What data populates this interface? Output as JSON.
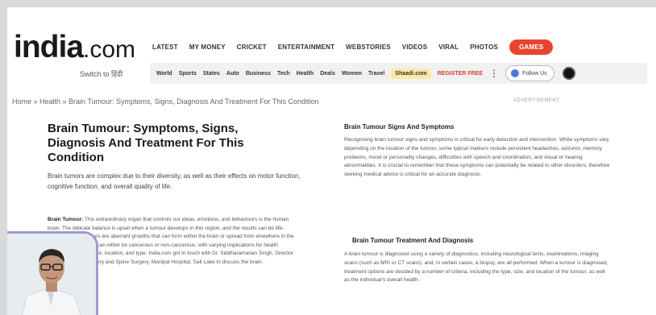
{
  "header": {
    "logo_main": "india",
    "logo_suffix": ".com",
    "switch_label": "Switch to हिंदी",
    "top_nav": [
      "LATEST",
      "MY MONEY",
      "CRICKET",
      "ENTERTAINMENT",
      "WEBSTORIES",
      "VIDEOS",
      "VIRAL",
      "PHOTOS"
    ],
    "games_label": "GAMES",
    "sub_nav": [
      "World",
      "Sports",
      "States",
      "Auto",
      "Business",
      "Tech",
      "Health",
      "Deals",
      "Women",
      "Travel"
    ],
    "shaadi_label": "Shaadi.com",
    "register_label": "REGISTER FREE",
    "follow_label": "Follow Us"
  },
  "breadcrumb": "Home » Health » Brain Tumour: Symptoms, Signs, Diagnosis And Treatment For This Condition",
  "ad_label": "ADVERTISEMENT",
  "article": {
    "title": "Brain Tumour: Symptoms, Signs, Diagnosis And Treatment For This Condition",
    "intro": "Brain tumors are complex due to their diversity, as well as their effects on motor function, cognitive function, and overall quality of life.",
    "para_lead": "Brain Tumour:",
    "para_body": "This extraordinary organ that controls our ideas, emotions, and behaviours is the human brain. The delicate balance is upset when a tumour develops in this region, and the results can be life-altering. Brain tumours are aberrant growths that can form within the brain or spread from elsewhere in the body. These growths can either be cancerous or non-cancerous, with varying implications for health depending on their size, location, and type. India.com got in touch with Dr. Siddharamanan Singh, Director and HOD, Neurosurgery and Spine Surgery, Manipal Hospital, Salt Lake to discuss the brain."
  },
  "right": {
    "heading1": "Brain Tumour Signs And Symptoms",
    "text1": "Recognising brain tumour signs and symptoms is critical for early detection and intervention. While symptoms vary depending on the location of the tumour, some typical markers include persistent headaches, seizures, memory problems, mood or personality changes, difficulties with speech and coordination, and visual or hearing abnormalities. It is crucial to remember that these symptoms can potentially be related to other disorders, therefore seeking medical advice is critical for an accurate diagnosis.",
    "heading2": "Brain Tumour Treatment And Diagnosis",
    "text2": "A brain tumour is diagnosed using a variety of diagnostics, including neurological tests, examinations, imaging scans (such as MRI or CT scans), and, in certain cases, a biopsy, are all performed. When a tumour is diagnosed, treatment options are decided by a number of criteria, including the type, size, and location of the tumour, as well as the individual's overall health."
  }
}
